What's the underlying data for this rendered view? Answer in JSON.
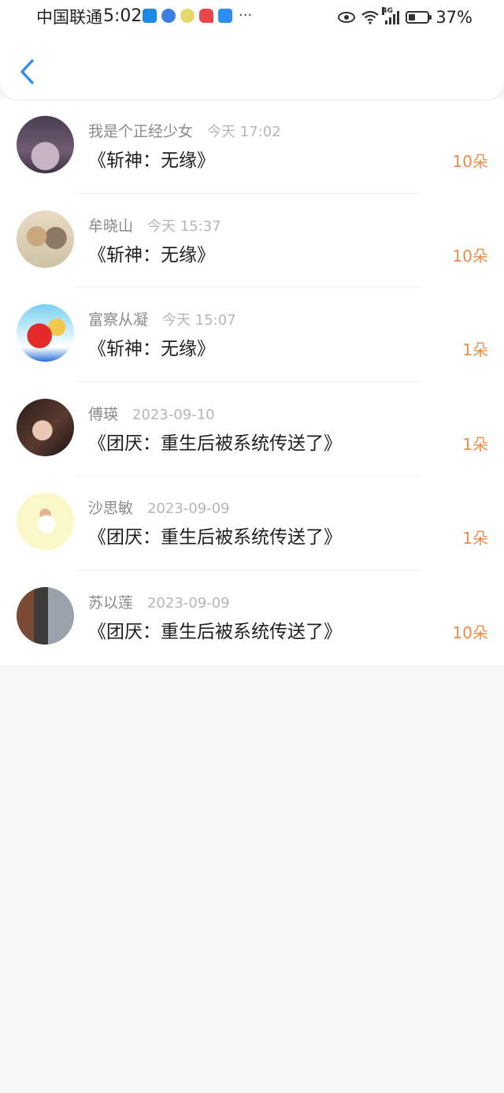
{
  "status_bar": {
    "carrier": "中国联通",
    "time": "5:02",
    "network": "4G",
    "battery": "37%",
    "notification_icons": [
      "weather-icon",
      "ball-app-icon",
      "face-app-icon",
      "red-app-icon",
      "search-app-icon"
    ],
    "more": "···"
  },
  "header": {
    "back_icon": "chevron-left-icon",
    "accent": "#2b8ef0"
  },
  "items": [
    {
      "name": "我是个正经少女",
      "date": "今天 17:02",
      "title": "《斩神：无缘》",
      "amount": "10朵"
    },
    {
      "name": "牟晓山",
      "date": "今天 15:37",
      "title": "《斩神：无缘》",
      "amount": "10朵"
    },
    {
      "name": "富察从凝",
      "date": "今天 15:07",
      "title": "《斩神：无缘》",
      "amount": "1朵"
    },
    {
      "name": "傅瑛",
      "date": "2023-09-10",
      "title": "《团厌：重生后被系统传送了》",
      "amount": "1朵"
    },
    {
      "name": "沙思敏",
      "date": "2023-09-09",
      "title": "《团厌：重生后被系统传送了》",
      "amount": "1朵"
    },
    {
      "name": "苏以莲",
      "date": "2023-09-09",
      "title": "《团厌：重生后被系统传送了》",
      "amount": "10朵"
    }
  ],
  "colors": {
    "amount": "#ef8c47",
    "background": "#f7f6f7"
  }
}
